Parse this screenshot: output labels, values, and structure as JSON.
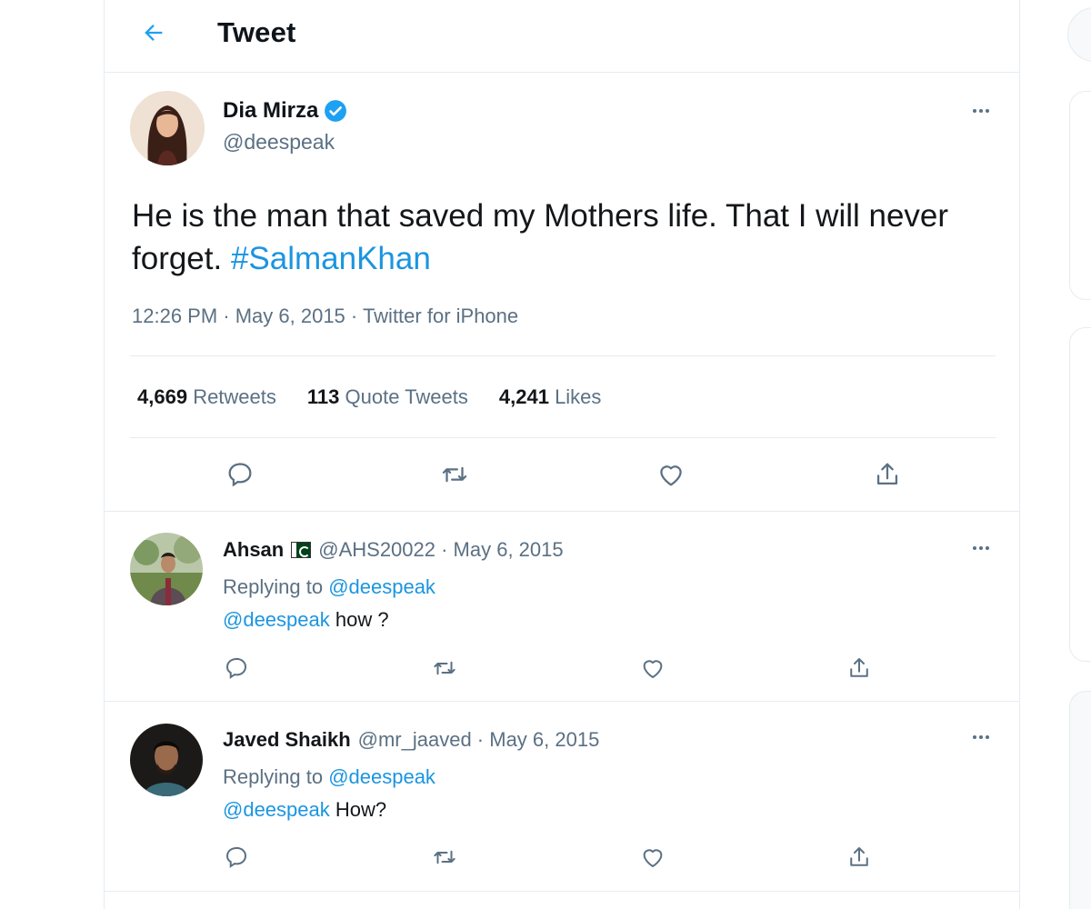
{
  "header": {
    "title": "Tweet"
  },
  "tweet": {
    "author_name": "Dia Mirza",
    "author_handle": "@deespeak",
    "text_before": "He is the man that saved my Mothers life. That I will never forget. ",
    "hashtag": "#SalmanKhan",
    "meta": "12:26 PM · May 6, 2015 · Twitter for iPhone",
    "stats": [
      {
        "count": "4,669",
        "label": "Retweets"
      },
      {
        "count": "113",
        "label": "Quote Tweets"
      },
      {
        "count": "4,241",
        "label": "Likes"
      }
    ]
  },
  "replies": [
    {
      "name": "Ahsan",
      "handle_date": "@AHS20022 · May 6, 2015",
      "replying_prefix": "Replying to ",
      "replying_to": "@deespeak",
      "mention": "@deespeak",
      "text": " how ?"
    },
    {
      "name": "Javed Shaikh",
      "handle_date": "@mr_jaaved · May 6, 2015",
      "replying_prefix": "Replying to ",
      "replying_to": "@deespeak",
      "mention": "@deespeak",
      "text": " How?"
    }
  ],
  "colors": {
    "accent": "#1b95e0",
    "muted": "#5b7083",
    "border": "#e6ecf0",
    "verified": "#1da1f2"
  }
}
